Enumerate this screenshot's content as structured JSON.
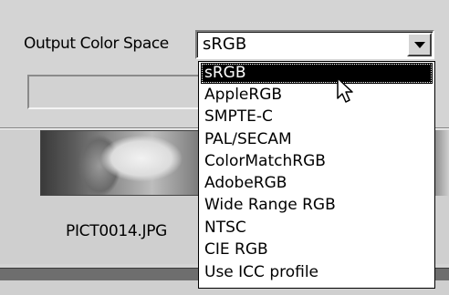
{
  "panel": {
    "output_color_space_label": "Output Color Space",
    "selected_value": "sRGB",
    "filename": "PICT0014.JPG"
  },
  "dropdown": {
    "items": [
      {
        "label": "sRGB",
        "selected": true
      },
      {
        "label": "AppleRGB"
      },
      {
        "label": "SMPTE-C"
      },
      {
        "label": "PAL/SECAM"
      },
      {
        "label": "ColorMatchRGB"
      },
      {
        "label": "AdobeRGB"
      },
      {
        "label": "Wide Range RGB"
      },
      {
        "label": "NTSC"
      },
      {
        "label": "CIE RGB"
      },
      {
        "label": "Use ICC profile"
      }
    ]
  },
  "icons": {
    "select_arrow": "chevron-down-icon",
    "pointer": "mouse-pointer-icon"
  },
  "colors": {
    "window_bg": "#d4d4d4",
    "selection_bg": "#000000",
    "selection_fg": "#ffffff"
  }
}
